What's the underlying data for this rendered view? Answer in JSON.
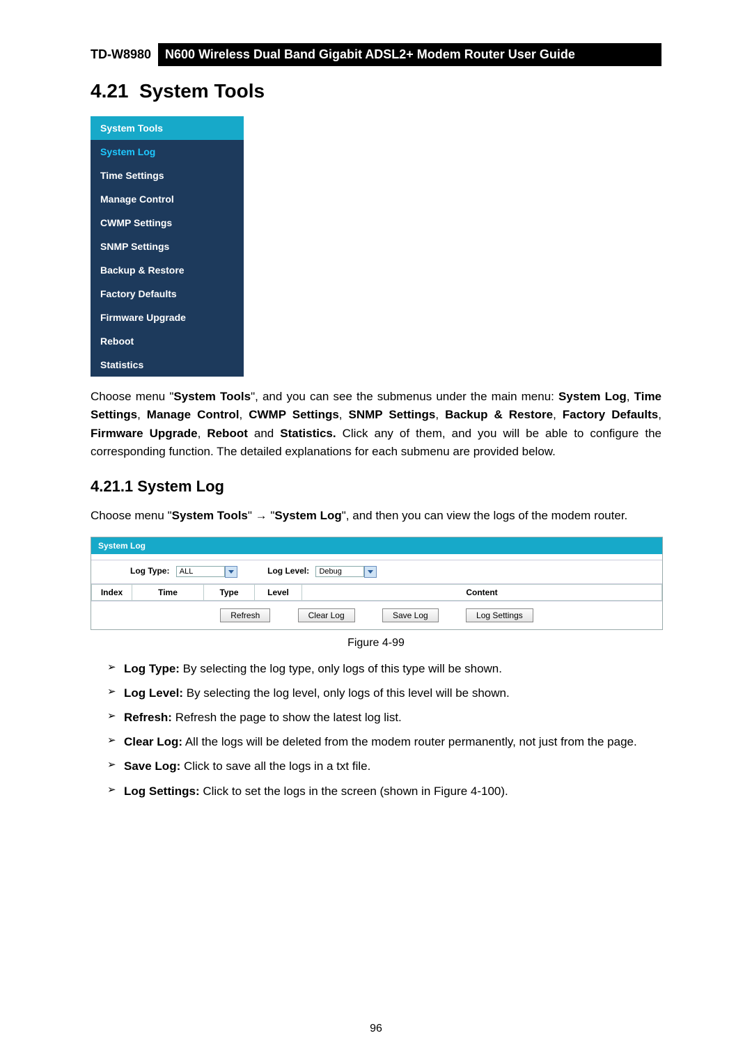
{
  "header": {
    "model": "TD-W8980",
    "title": "N600 Wireless Dual Band Gigabit ADSL2+ Modem Router User Guide"
  },
  "section": {
    "number": "4.21",
    "title": "System Tools"
  },
  "menu": {
    "header": "System Tools",
    "active": "System Log",
    "items": [
      "Time Settings",
      "Manage Control",
      "CWMP Settings",
      "SNMP Settings",
      "Backup & Restore",
      "Factory Defaults",
      "Firmware Upgrade",
      "Reboot",
      "Statistics"
    ]
  },
  "para1": {
    "t0": "Choose menu \"",
    "b0": "System Tools",
    "t1": "\", and you can see the submenus under the main menu: ",
    "b1": "System Log",
    "t2": ", ",
    "b2": "Time Settings",
    "t3": ", ",
    "b3": "Manage Control",
    "t4": ", ",
    "b4": "CWMP Settings",
    "t5": ", ",
    "b5": "SNMP Settings",
    "t6": ", ",
    "b6": "Backup & Restore",
    "t7": ", ",
    "b7": "Factory Defaults",
    "t8": ", ",
    "b8": "Firmware Upgrade",
    "t9": ", ",
    "b9": "Reboot",
    "t10": " and ",
    "b10": "Statistics.",
    "t11": " Click any of them, and you will be able to configure the corresponding function. The detailed explanations for each submenu are provided below."
  },
  "subsection": {
    "number": "4.21.1",
    "title": "System Log"
  },
  "para2": {
    "t0": "Choose menu \"",
    "b0": "System Tools",
    "t1": "\" → \"",
    "b1": "System Log",
    "t2": "\", and then you can view the logs of the modem router."
  },
  "syslog": {
    "title": "System Log",
    "logTypeLabel": "Log Type:",
    "logTypeValue": "ALL",
    "logLevelLabel": "Log Level:",
    "logLevelValue": "Debug",
    "cols": {
      "index": "Index",
      "time": "Time",
      "type": "Type",
      "level": "Level",
      "content": "Content"
    },
    "buttons": {
      "refresh": "Refresh",
      "clear": "Clear Log",
      "save": "Save Log",
      "settings": "Log Settings"
    }
  },
  "figureCaption": "Figure 4-99",
  "bullets": [
    {
      "b": "Log Type:",
      "t": " By selecting the log type, only logs of this type will be shown."
    },
    {
      "b": "Log Level:",
      "t": " By selecting the log level, only logs of this level will be shown."
    },
    {
      "b": "Refresh:",
      "t": " Refresh the page to show the latest log list."
    },
    {
      "b": "Clear Log:",
      "t": " All the logs will be deleted from the modem router permanently, not just from the page."
    },
    {
      "b": "Save Log:",
      "t": " Click to save all the logs in a txt file."
    },
    {
      "b": "Log Settings:",
      "t": " Click to set the logs in the screen (shown in Figure 4-100)."
    }
  ],
  "pageNumber": "96"
}
